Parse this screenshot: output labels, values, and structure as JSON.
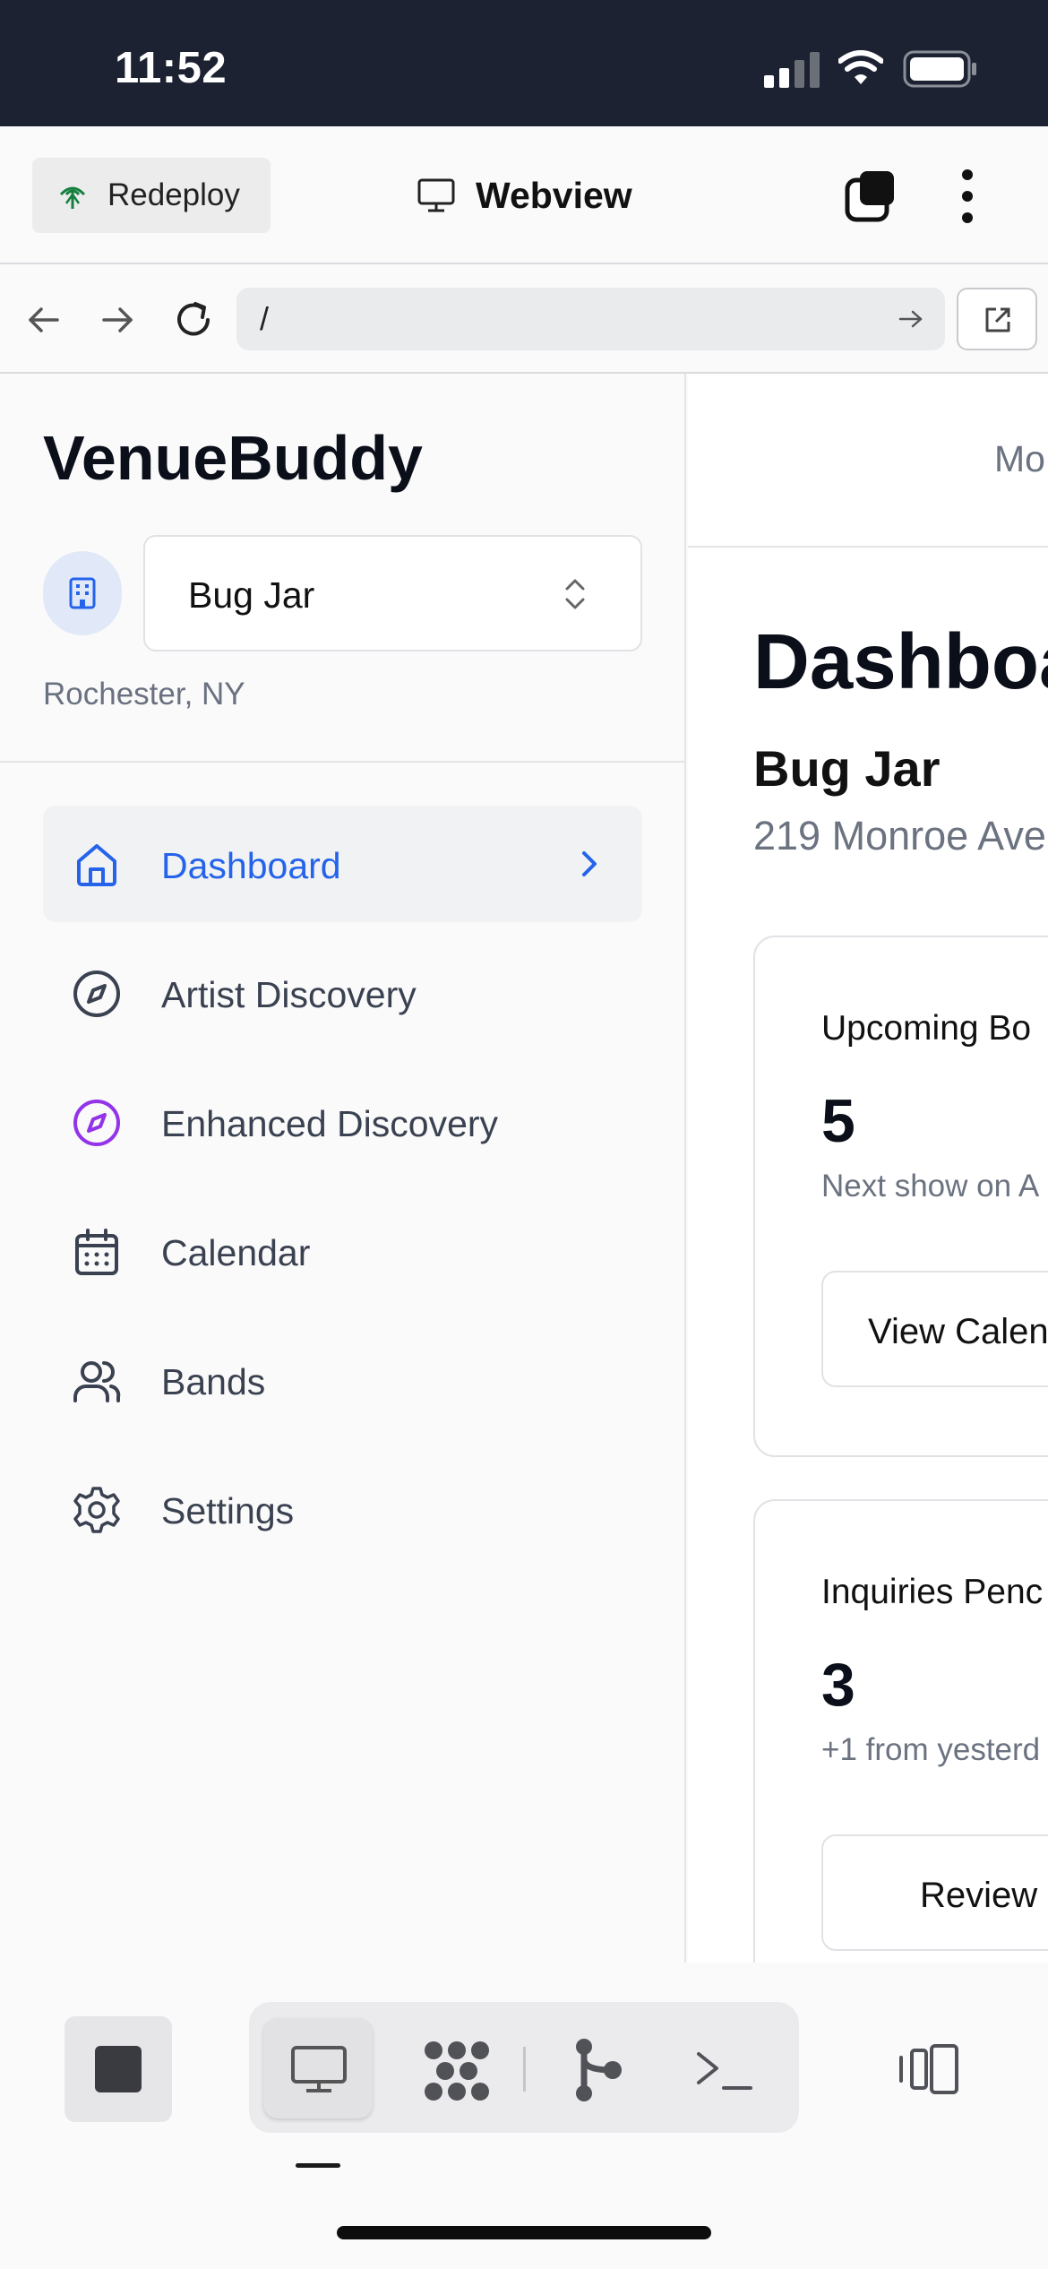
{
  "status_bar": {
    "time": "11:52"
  },
  "toolbar": {
    "redeploy_label": "Redeploy",
    "webview_title": "Webview"
  },
  "url_bar": {
    "path": "/"
  },
  "sidebar": {
    "app_title": "VenueBuddy",
    "venue_select": {
      "value": "Bug Jar"
    },
    "venue_location": "Rochester, NY",
    "nav_items": [
      {
        "label": "Dashboard",
        "icon": "home-icon",
        "active": true
      },
      {
        "label": "Artist Discovery",
        "icon": "compass-icon",
        "active": false
      },
      {
        "label": "Enhanced Discovery",
        "icon": "compass-icon",
        "active": false
      },
      {
        "label": "Calendar",
        "icon": "calendar-icon",
        "active": false
      },
      {
        "label": "Bands",
        "icon": "users-icon",
        "active": false
      },
      {
        "label": "Settings",
        "icon": "gear-icon",
        "active": false
      }
    ]
  },
  "main": {
    "header_tab_text": "Mo",
    "page_title": "Dashboa",
    "venue_name": "Bug Jar",
    "venue_address": "219 Monroe Ave",
    "cards": [
      {
        "title": "Upcoming Bo",
        "value": "5",
        "subtitle": "Next show on A",
        "button_label": "View Calen"
      },
      {
        "title": "Inquiries Penc",
        "value": "3",
        "subtitle": "+1 from yesterd",
        "button_label": "Review"
      }
    ]
  },
  "colors": {
    "accent": "#2563eb",
    "enhanced_accent": "#9333ea",
    "status_bar_bg": "#1c2232"
  }
}
